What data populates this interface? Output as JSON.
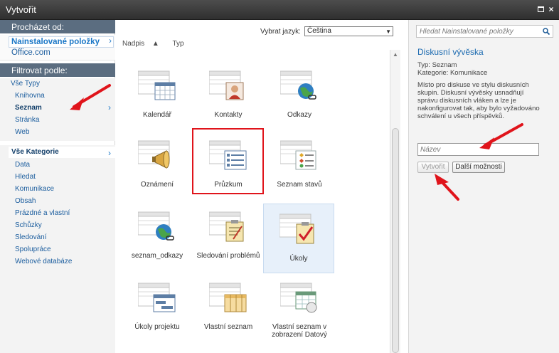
{
  "window": {
    "title": "Vytvořit"
  },
  "left": {
    "browse_header": "Procházet od:",
    "browse_items": [
      "Nainstalované položky",
      "Office.com"
    ],
    "filter_header": "Filtrovat podle:",
    "types": [
      "Vše Typy",
      "Knihovna",
      "Seznam",
      "Stránka",
      "Web"
    ],
    "categories_header": "Vše Kategorie",
    "categories": [
      "Data",
      "Hledat",
      "Komunikace",
      "Obsah",
      "Prázdné a vlastní",
      "Schůzky",
      "Sledování",
      "Spolupráce",
      "Webové databáze"
    ]
  },
  "middle": {
    "sort": [
      "Nadpis",
      "Typ"
    ],
    "language_label": "Vybrat jazyk:",
    "language_value": "Čeština",
    "tiles": [
      {
        "label": "Kalendář",
        "icon": "calendar-icon"
      },
      {
        "label": "Kontakty",
        "icon": "contacts-icon"
      },
      {
        "label": "Odkazy",
        "icon": "links-icon"
      },
      {
        "label": "Oznámení",
        "icon": "announcement-icon"
      },
      {
        "label": "Průzkum",
        "icon": "survey-icon"
      },
      {
        "label": "Seznam stavů",
        "icon": "status-list-icon"
      },
      {
        "label": "seznam_odkazy",
        "icon": "links-icon"
      },
      {
        "label": "Sledování problémů",
        "icon": "issue-tracking-icon"
      },
      {
        "label": "Úkoly",
        "icon": "tasks-icon"
      },
      {
        "label": "Úkoly projektu",
        "icon": "project-tasks-icon"
      },
      {
        "label": "Vlastní seznam",
        "icon": "custom-list-icon"
      },
      {
        "label": "Vlastní seznam v zobrazení Datový",
        "icon": "datasheet-list-icon"
      }
    ]
  },
  "right": {
    "search_placeholder": "Hledat Nainstalované položky",
    "title": "Diskusní vývěska",
    "type_line": "Typ: Seznam",
    "category_line": "Kategorie: Komunikace",
    "description": "Místo pro diskuse ve stylu diskusních skupin. Diskusní vývěsky usnadňují správu diskusních vláken a lze je nakonfigurovat tak, aby bylo vyžadováno schválení u všech příspěvků.",
    "name_placeholder": "Název",
    "create_label": "Vytvořit",
    "more_label": "Další možnosti"
  },
  "colors": {
    "accent": "#1b6ab0",
    "header_bg": "#5b6d80",
    "highlight": "#e0141b"
  }
}
